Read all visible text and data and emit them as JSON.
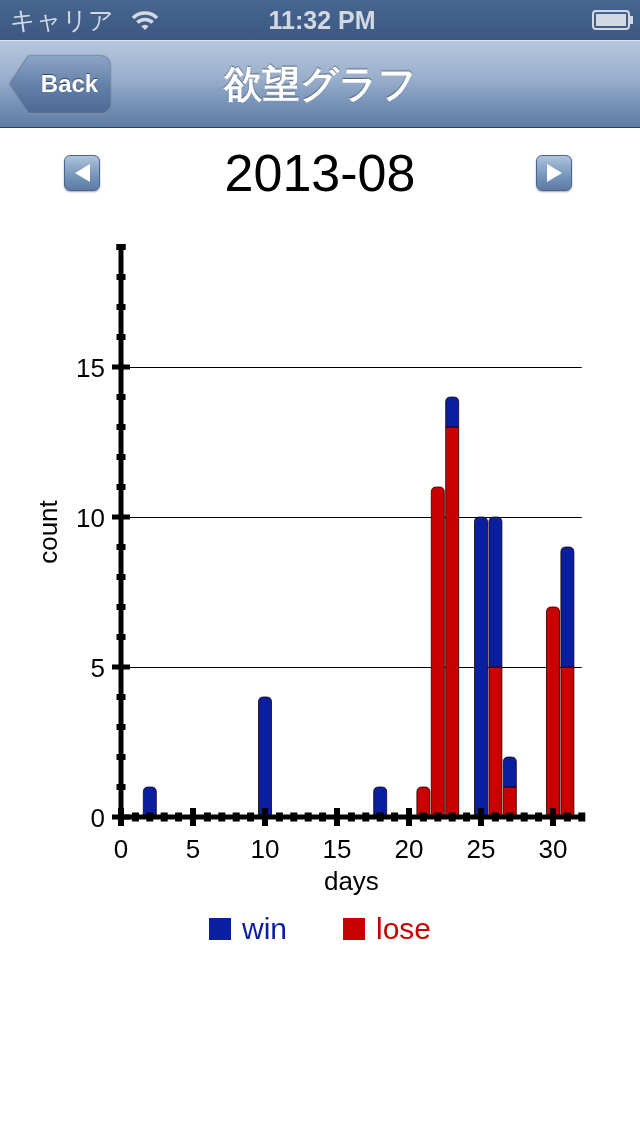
{
  "status_bar": {
    "carrier": "キャリア",
    "time": "11:32 PM"
  },
  "nav_bar": {
    "back_button": "Back",
    "title": "欲望グラフ"
  },
  "month_selector": {
    "month": "2013-08"
  },
  "chart": {
    "chart_data": {
      "type": "bar",
      "xlabel": "days",
      "ylabel": "count",
      "x": [
        2,
        10,
        18,
        21,
        22,
        23,
        25,
        26,
        27,
        30,
        31
      ],
      "series": [
        {
          "name": "win",
          "color": "#0a1fa0",
          "values": [
            1,
            4,
            1,
            0,
            0,
            1,
            10,
            5,
            1,
            0,
            4
          ]
        },
        {
          "name": "lose",
          "color": "#c80000",
          "values": [
            0,
            0,
            0,
            1,
            11,
            13,
            0,
            5,
            1,
            7,
            5
          ]
        }
      ],
      "stacked": true,
      "grid": true,
      "legend": "bottom",
      "xlim": [
        0,
        32
      ],
      "ylim": [
        0,
        19
      ],
      "xticks": [
        0,
        5,
        10,
        15,
        20,
        25,
        30
      ],
      "yticks": [
        0,
        5,
        10,
        15
      ]
    }
  }
}
